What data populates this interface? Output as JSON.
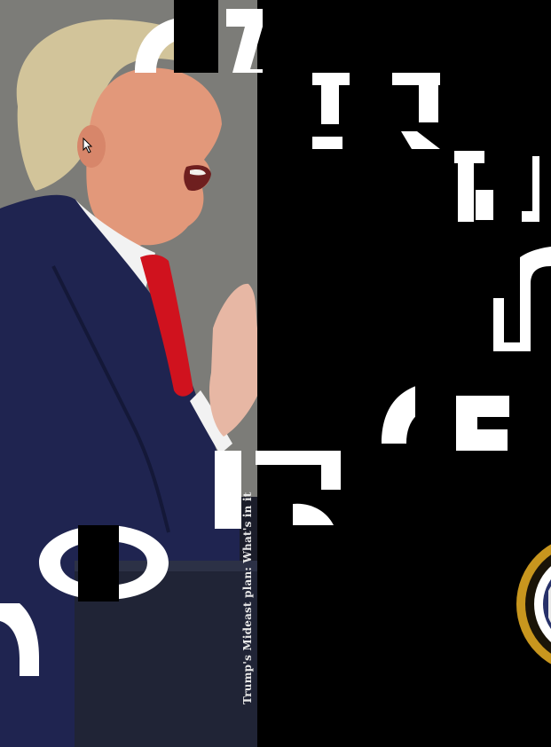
{
  "caption": {
    "headline": "Trump's Mideast plan: What's in it"
  },
  "colors": {
    "background": "#000000",
    "suit": "#1f2450",
    "tie": "#d0121e",
    "glyph": "#ffffff",
    "seal_gold": "#c8961e"
  },
  "icons": {
    "cursor": "mouse-pointer-icon",
    "seal": "presidential-seal-icon"
  }
}
